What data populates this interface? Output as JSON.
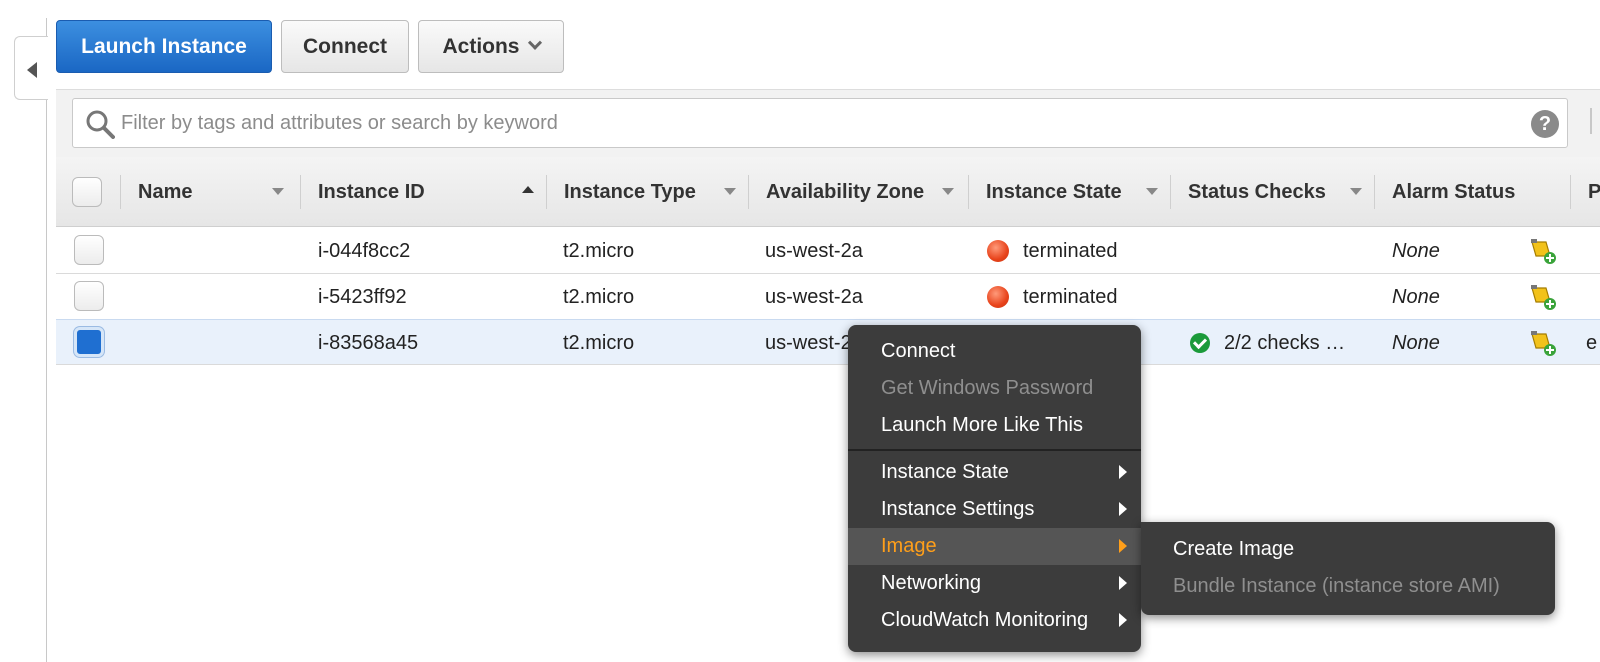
{
  "toolbar": {
    "launch_label": "Launch Instance",
    "connect_label": "Connect",
    "actions_label": "Actions"
  },
  "filter": {
    "placeholder": "Filter by tags and attributes or search by keyword",
    "help": "?"
  },
  "columns": [
    {
      "label": "Name",
      "sort": "desc"
    },
    {
      "label": "Instance ID",
      "sort": "asc"
    },
    {
      "label": "Instance Type",
      "sort": "desc"
    },
    {
      "label": "Availability Zone",
      "sort": "desc"
    },
    {
      "label": "Instance State",
      "sort": "desc"
    },
    {
      "label": "Status Checks",
      "sort": "desc"
    },
    {
      "label": "Alarm Status",
      "sort": "none"
    },
    {
      "label": "P",
      "sort": "none"
    }
  ],
  "rows": [
    {
      "name": "",
      "instance_id": "i-044f8cc2",
      "instance_type": "t2.micro",
      "zone": "us-west-2a",
      "state": "terminated",
      "status_checks": "",
      "alarm": "None",
      "extra": "",
      "selected": false
    },
    {
      "name": "",
      "instance_id": "i-5423ff92",
      "instance_type": "t2.micro",
      "zone": "us-west-2a",
      "state": "terminated",
      "status_checks": "",
      "alarm": "None",
      "extra": "",
      "selected": false
    },
    {
      "name": "",
      "instance_id": "i-83568a45",
      "instance_type": "t2.micro",
      "zone": "us-west-2",
      "state": "",
      "status_checks": "2/2 checks …",
      "alarm": "None",
      "extra": "e",
      "selected": true
    }
  ],
  "context_menu": {
    "items": [
      {
        "label": "Connect",
        "disabled": false,
        "submenu": false
      },
      {
        "label": "Get Windows Password",
        "disabled": true,
        "submenu": false
      },
      {
        "label": "Launch More Like This",
        "disabled": false,
        "submenu": false
      },
      {
        "label": "Instance State",
        "disabled": false,
        "submenu": true
      },
      {
        "label": "Instance Settings",
        "disabled": false,
        "submenu": true
      },
      {
        "label": "Image",
        "disabled": false,
        "submenu": true,
        "active": true
      },
      {
        "label": "Networking",
        "disabled": false,
        "submenu": true
      },
      {
        "label": "CloudWatch Monitoring",
        "disabled": false,
        "submenu": true
      }
    ],
    "image_submenu": [
      {
        "label": "Create Image",
        "disabled": false
      },
      {
        "label": "Bundle Instance (instance store AMI)",
        "disabled": true
      }
    ]
  },
  "colors": {
    "primary": "#1f6fd1",
    "terminated": "#e8431b",
    "check_ok": "#1b9a3a",
    "menu_bg": "#3c3c3c",
    "menu_active_text": "#ff9f1a"
  },
  "icons": {
    "search": "search-icon",
    "help": "help-icon",
    "alarm": "add-alarm-icon",
    "collapse": "collapse-left-icon"
  }
}
